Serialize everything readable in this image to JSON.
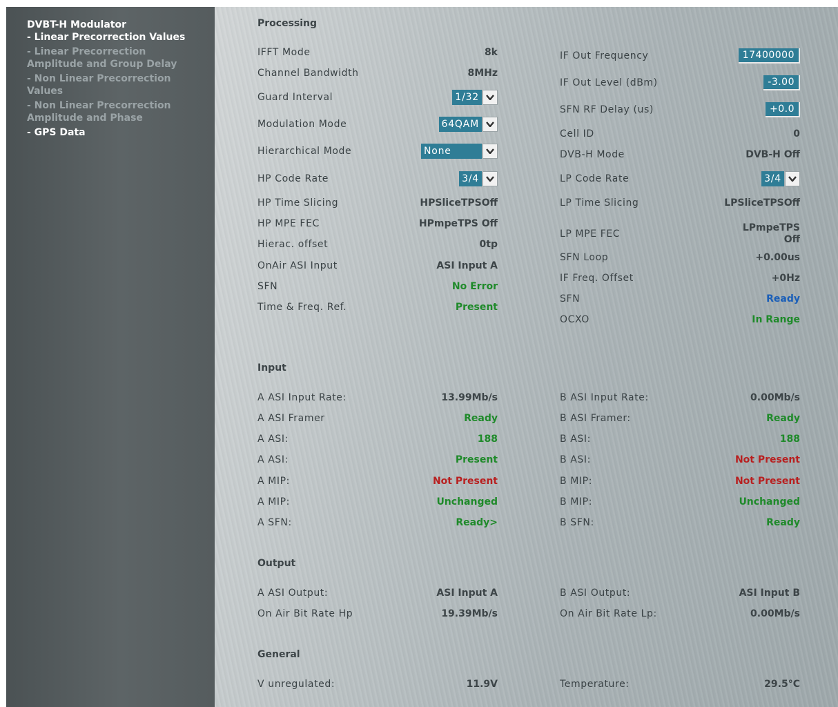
{
  "sidebar": {
    "title": "DVBT-H Modulator",
    "items": [
      {
        "label": "- Linear Precorrection Values",
        "active": true
      },
      {
        "label": "- Linear Precorrection Amplitude and Group Delay",
        "active": false
      },
      {
        "label": "- Non Linear Precorrection Values",
        "active": false
      },
      {
        "label": "- Non Linear Precorrection Amplitude and Phase",
        "active": false
      },
      {
        "label": "- GPS Data",
        "active": true
      }
    ]
  },
  "processing": {
    "title": "Processing",
    "left": [
      {
        "label": "IFFT Mode",
        "value": "8k"
      },
      {
        "label": "Channel Bandwidth",
        "value": "8MHz"
      },
      {
        "label": "Guard Interval",
        "select": "1/32"
      },
      {
        "label": "Modulation Mode",
        "select": "64QAM"
      },
      {
        "label": "Hierarchical Mode",
        "select": "None"
      },
      {
        "label": "HP Code Rate",
        "select": "3/4"
      },
      {
        "label": "HP Time Slicing",
        "value": "HPSliceTPSOff"
      },
      {
        "label": "HP MPE FEC",
        "value": "HPmpeTPS Off"
      },
      {
        "label": "Hierac. offset",
        "value": "0tp"
      },
      {
        "label": "OnAir ASI Input",
        "value": "ASI Input A"
      },
      {
        "label": "SFN",
        "value": "No Error"
      },
      {
        "label": "Time & Freq. Ref.",
        "value": "Present"
      }
    ],
    "right": [
      {
        "label": "IF Out Frequency",
        "input": "17400000"
      },
      {
        "label": "IF Out Level (dBm)",
        "input": "-3.00"
      },
      {
        "label": "SFN RF Delay (us)",
        "input": "+0.0"
      },
      {
        "label": "Cell ID",
        "value": "0"
      },
      {
        "label": "DVB-H Mode",
        "value": "DVB-H Off"
      },
      {
        "label": "LP Code Rate",
        "select": "3/4"
      },
      {
        "label": "LP Time Slicing",
        "value": "LPSliceTPSOff"
      },
      {
        "label": "LP MPE FEC",
        "value": "LPmpeTPS Off"
      },
      {
        "label": "SFN Loop",
        "value": "+0.00us"
      },
      {
        "label": "IF Freq. Offset",
        "value": "+0Hz"
      },
      {
        "label": "SFN",
        "value": "Ready"
      },
      {
        "label": "OCXO",
        "value": "In Range"
      }
    ]
  },
  "input": {
    "title": "Input",
    "left": [
      {
        "label": "A ASI Input Rate:",
        "value": "13.99Mb/s"
      },
      {
        "label": "A ASI Framer",
        "value": "Ready"
      },
      {
        "label": "A ASI:",
        "value": "188"
      },
      {
        "label": "A ASI:",
        "value": "Present"
      },
      {
        "label": "A MIP:",
        "value": "Not Present"
      },
      {
        "label": "A MIP:",
        "value": "Unchanged"
      },
      {
        "label": "A SFN:",
        "value": "Ready>"
      }
    ],
    "right": [
      {
        "label": "B ASI Input Rate:",
        "value": "0.00Mb/s"
      },
      {
        "label": "B ASI Framer:",
        "value": "Ready"
      },
      {
        "label": "B ASI:",
        "value": "188"
      },
      {
        "label": "B ASI:",
        "value": "Not Present"
      },
      {
        "label": "B MIP:",
        "value": "Not Present"
      },
      {
        "label": "B MIP:",
        "value": "Unchanged"
      },
      {
        "label": "B SFN:",
        "value": "Ready"
      }
    ]
  },
  "output": {
    "title": "Output",
    "left": [
      {
        "label": "A ASI Output:",
        "value": "ASI Input A"
      },
      {
        "label": "On Air Bit Rate Hp",
        "value": "19.39Mb/s"
      }
    ],
    "right": [
      {
        "label": "B ASI Output:",
        "value": "ASI Input B"
      },
      {
        "label": "On Air Bit Rate Lp:",
        "value": "0.00Mb/s"
      }
    ]
  },
  "general": {
    "title": "General",
    "left": [
      {
        "label": "V unregulated:",
        "value": "11.9V"
      }
    ],
    "right": [
      {
        "label": "Temperature:",
        "value": "29.5°C"
      }
    ]
  },
  "colors": {
    "status_green": "#1f8a2a",
    "status_red": "#b82020",
    "status_blue": "#1b5fb8",
    "control_blue": "#2f7d96"
  }
}
